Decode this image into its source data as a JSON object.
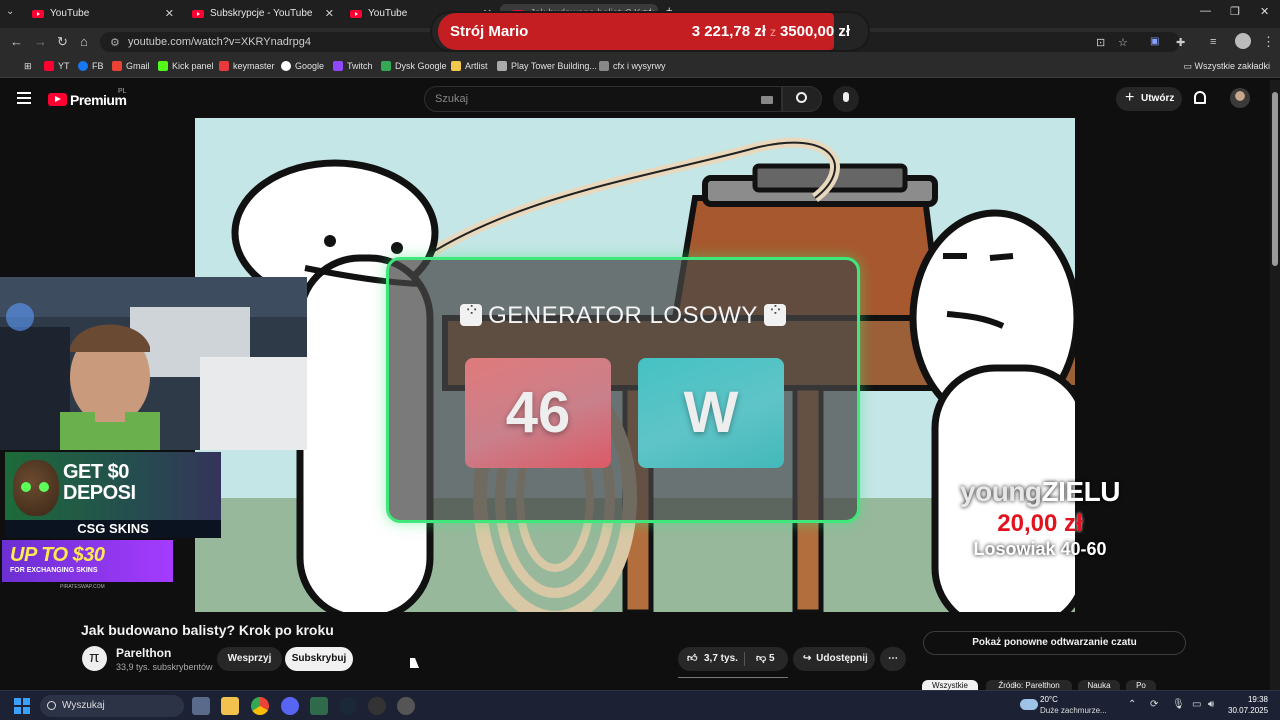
{
  "browser": {
    "tabs": [
      {
        "title": "YouTube"
      },
      {
        "title": "Subskrypcje - YouTube"
      },
      {
        "title": "YouTube"
      },
      {
        "title": "Jak budowano balisty? Krok"
      }
    ],
    "url": "youtube.com/watch?v=XKRYnadrpg4",
    "bookmarks": [
      "YT",
      "FB",
      "Gmail",
      "Kick panel",
      "keymaster",
      "Google",
      "Twitch",
      "Dysk Google",
      "Artlist",
      "Play Tower Building...",
      "cfx i wysyrwy"
    ],
    "all_bookmarks": "Wszystkie zakładki"
  },
  "donation_bar": {
    "goal_name": "Strój Mario",
    "current": "3 221,78 zł",
    "separator": "z",
    "target": "3500,00 zł",
    "progress": 0.92,
    "color": "#c41e22"
  },
  "youtube": {
    "logo_text": "Premium",
    "logo_region": "PL",
    "search_placeholder": "Szukaj",
    "create_label": "Utwórz"
  },
  "overlay": {
    "generator_title": "GENERATOR LOSOWY",
    "slot_number": "46",
    "slot_letter": "W",
    "border_color": "#3ee87a",
    "donor_name_a": "young",
    "donor_name_b": "ZIELU",
    "donor_amount": "20,00 zł",
    "donor_message": "Losowiak 40-60"
  },
  "ads": {
    "ad1_line1": "GET $0",
    "ad1_line2": "DEPOSI",
    "ad1_brand": "CSG SKINS",
    "ad2_line1": "UP TO $30",
    "ad2_line2": "FOR EXCHANGING SKINS",
    "ad2_brand": "PIRATESWAP.COM"
  },
  "video": {
    "title": "Jak budowano balisty? Krok po kroku",
    "channel": "Parelthon",
    "subscribers": "33,9 tys. subskrybentów",
    "support_label": "Wesprzyj",
    "subscribe_label": "Subskrybuj",
    "likes": "3,7 tys.",
    "dislikes": "5",
    "share_label": "Udostępnij",
    "chat_replay": "Pokaż ponowne odtwarzanie czatu",
    "chips": [
      "Wszystkie",
      "Źródło: Parelthon",
      "Nauka",
      "Po"
    ]
  },
  "taskbar": {
    "search_label": "Wyszukaj",
    "temperature": "20°C",
    "weather": "Duże zachmurze...",
    "time": "19:38",
    "date": "30.07.2025"
  }
}
